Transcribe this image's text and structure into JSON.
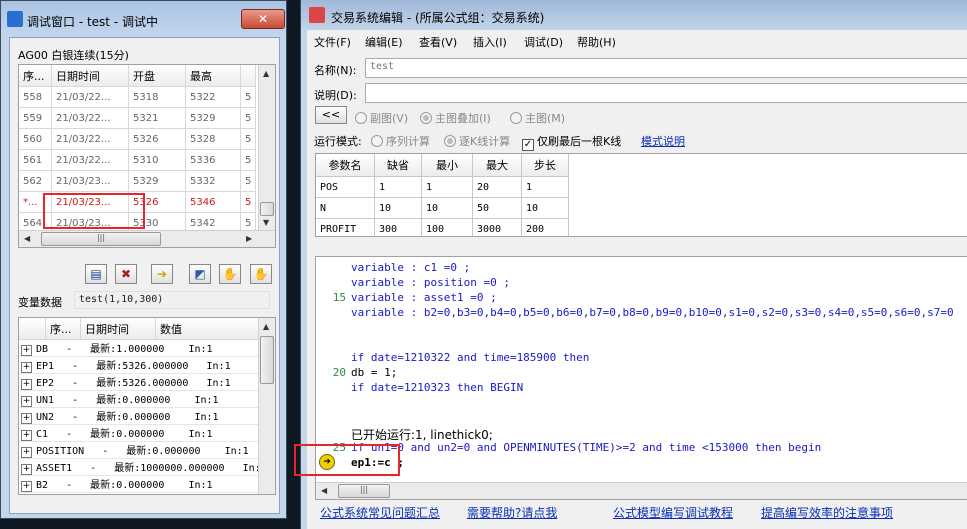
{
  "colors": {
    "accent_red": "#e6262e",
    "keyword_blue": "#1919c8",
    "link_blue": "#0a2fb5",
    "line_number_green": "#2f8a4a",
    "window_frame": "#c6d6ea"
  },
  "debug_window": {
    "title": "调试窗口  - test - 调试中",
    "close_label": "✕",
    "contract_label": "AG00 白银连续(15分)",
    "price_columns": [
      "序...",
      "日期时间",
      "开盘",
      "最高",
      ""
    ],
    "price_rows": [
      [
        "558",
        "21/03/22...",
        "5318",
        "5322",
        "5"
      ],
      [
        "559",
        "21/03/22...",
        "5321",
        "5329",
        "5"
      ],
      [
        "560",
        "21/03/22...",
        "5326",
        "5328",
        "5"
      ],
      [
        "561",
        "21/03/22...",
        "5310",
        "5336",
        "5"
      ],
      [
        "562",
        "21/03/23...",
        "5329",
        "5332",
        "5"
      ],
      [
        "*...",
        "21/03/23...",
        "5326",
        "5346",
        "5"
      ],
      [
        "564",
        "21/03/23...",
        "5330",
        "5342",
        "5"
      ]
    ],
    "toolbar_icons": [
      "step-into-icon",
      "stop-icon",
      "run-to-icon",
      "chart-icon",
      "hand-icon",
      "breakpoint-hand-icon"
    ],
    "vars_label": "变量数据",
    "vars_args": "test(1,10,300)",
    "var_columns": [
      "序...",
      "日期时间",
      "数值"
    ],
    "var_rows": [
      "DB   -   最新:1.000000    In:1",
      "EP1   -   最新:5326.000000   In:1",
      "EP2   -   最新:5326.000000   In:1",
      "UN1   -   最新:0.000000    In:1",
      "UN2   -   最新:0.000000    In:1",
      "C1   -   最新:0.000000    In:1",
      "POSITION   -   最新:0.000000    In:1",
      "ASSET1   -   最新:1000000.000000   In:1",
      "B2   -   最新:0.000000    In:1"
    ]
  },
  "editor_window": {
    "title": "交易系统编辑 - (所属公式组：交易系统)",
    "menu": [
      "文件(F)",
      "编辑(E)",
      "查看(V)",
      "插入(I)",
      "调试(D)",
      "帮助(H)"
    ],
    "name_label": "名称(N):",
    "name_value": "test",
    "desc_label": "说明(D):",
    "desc_value": "",
    "collapse_button": "<<",
    "chart_modes": [
      "副图(V)",
      "主图叠加(I)",
      "主图(M)"
    ],
    "run_mode_label": "运行模式:",
    "run_modes": [
      "序列计算",
      "逐K线计算"
    ],
    "last_bar_label": "仅刷最后一根K线",
    "mode_help_link": "模式说明",
    "param_columns": [
      "参数名",
      "缺省",
      "最小",
      "最大",
      "步长"
    ],
    "param_rows": [
      [
        "POS",
        "1",
        "1",
        "20",
        "1"
      ],
      [
        "N",
        "10",
        "10",
        "50",
        "10"
      ],
      [
        "PROFIT",
        "300",
        "100",
        "3000",
        "200"
      ]
    ],
    "code_lines": [
      {
        "n": "",
        "t": "variable : c1 =0 ;"
      },
      {
        "n": "",
        "t": "variable : position =0 ;"
      },
      {
        "n": "15",
        "t": "variable : asset1 =0 ;"
      },
      {
        "n": "",
        "t": "variable : b2=0,b3=0,b4=0,b5=0,b6=0,b7=0,b8=0,b9=0,b10=0,s1=0,s2=0,s3=0,s4=0,s5=0,s6=0,s7=0"
      },
      {
        "n": "",
        "t": ""
      },
      {
        "n": "",
        "t": ""
      },
      {
        "n": "",
        "t": "if date=1210322 and time=185900 then"
      },
      {
        "n": "20",
        "t": "db = 1;"
      },
      {
        "n": "",
        "t": "if date=1210323 then BEGIN"
      },
      {
        "n": "",
        "t": ""
      },
      {
        "n": "",
        "t": ""
      },
      {
        "n": "",
        "t": "已开始运行:1, linethick0;"
      },
      {
        "n": "25",
        "t": "if un1=0 and un2=0 and OPENMINUTES(TIME)>=2 and time <153000 then begin"
      },
      {
        "n": "",
        "t": "ep1:=c ;"
      }
    ],
    "footer_links": [
      "公式系统常见问题汇总",
      "需要帮助?请点我",
      "公式模型编写调试教程",
      "提高编写效率的注意事项"
    ]
  }
}
